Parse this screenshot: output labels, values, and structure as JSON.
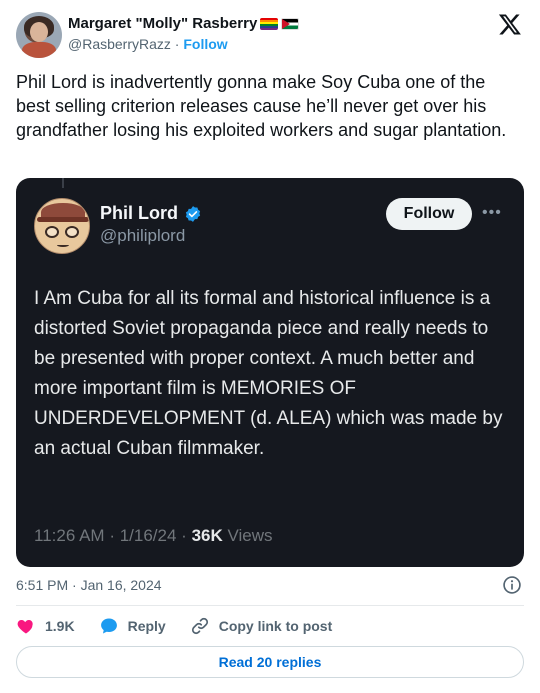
{
  "author": {
    "display_name": "Margaret \"Molly\" Rasberry",
    "handle": "@RasberryRazz",
    "separator": "·",
    "follow_label": "Follow"
  },
  "tweet": {
    "text": "Phil Lord is inadvertently gonna make Soy Cuba one of the best selling criterion releases cause he’ll never get over his grandfather losing his exploited workers and sugar plantation."
  },
  "quoted": {
    "name": "Phil Lord",
    "handle": "@philiplord",
    "follow_label": "Follow",
    "more_label": "•••",
    "text": "I Am Cuba for all its formal and historical influence is a distorted Soviet propaganda piece and really needs to be presented with proper context. A much better and more important film is MEMORIES OF UNDERDEVELOPMENT (d. ALEA) which was made by an actual Cuban filmmaker.",
    "time": "11:26 AM",
    "date": "1/16/24",
    "views_count": "36K",
    "views_label": "Views"
  },
  "timestamp": "6:51 PM · Jan 16, 2024",
  "actions": {
    "like_count": "1.9K",
    "reply_label": "Reply",
    "copy_label": "Copy link to post"
  },
  "read_replies_label": "Read 20 replies",
  "colors": {
    "accent": "#1d9bf0",
    "like": "#f91880",
    "card_bg": "#15181f"
  }
}
